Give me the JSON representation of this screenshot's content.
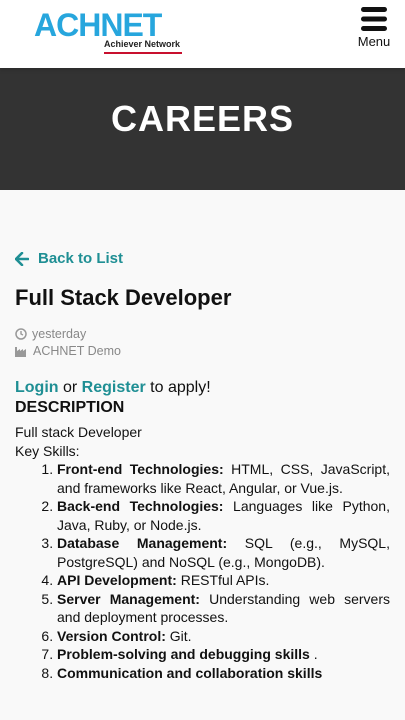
{
  "header": {
    "logo_text": "ACHNET",
    "logo_tagline": "Achiever Network",
    "menu_label": "Menu"
  },
  "hero": {
    "title": "CAREERS"
  },
  "job": {
    "back_label": "Back to List",
    "title": "Full Stack Developer",
    "posted": "yesterday",
    "company": "ACHNET Demo",
    "apply": {
      "login": "Login",
      "or": " or ",
      "register": "Register",
      "suffix": " to apply!"
    },
    "description_heading": "DESCRIPTION",
    "intro_line1": "Full stack Developer",
    "intro_line2": "Key Skills:",
    "skills": [
      {
        "label": "Front-end Technologies:",
        "text": " HTML, CSS, JavaScript, and frameworks like React, Angular, or Vue.js."
      },
      {
        "label": "Back-end Technologies:",
        "text": " Languages like Python, Java, Ruby, or Node.js."
      },
      {
        "label": "Database Management:",
        "text": " SQL (e.g., MySQL, PostgreSQL) and NoSQL (e.g., MongoDB)."
      },
      {
        "label": "API Development:",
        "text": " RESTful APIs."
      },
      {
        "label": "Server Management:",
        "text": " Understanding web servers and deployment processes."
      },
      {
        "label": "Version Control:",
        "text": " Git."
      },
      {
        "label": "Problem-solving and debugging skills",
        "text": " ."
      },
      {
        "label": "Communication and collaboration skills",
        "text": ""
      }
    ]
  },
  "colors": {
    "accent": "#1f8f94",
    "logo_blue": "#27a6dd",
    "hero_bg": "#333333"
  }
}
